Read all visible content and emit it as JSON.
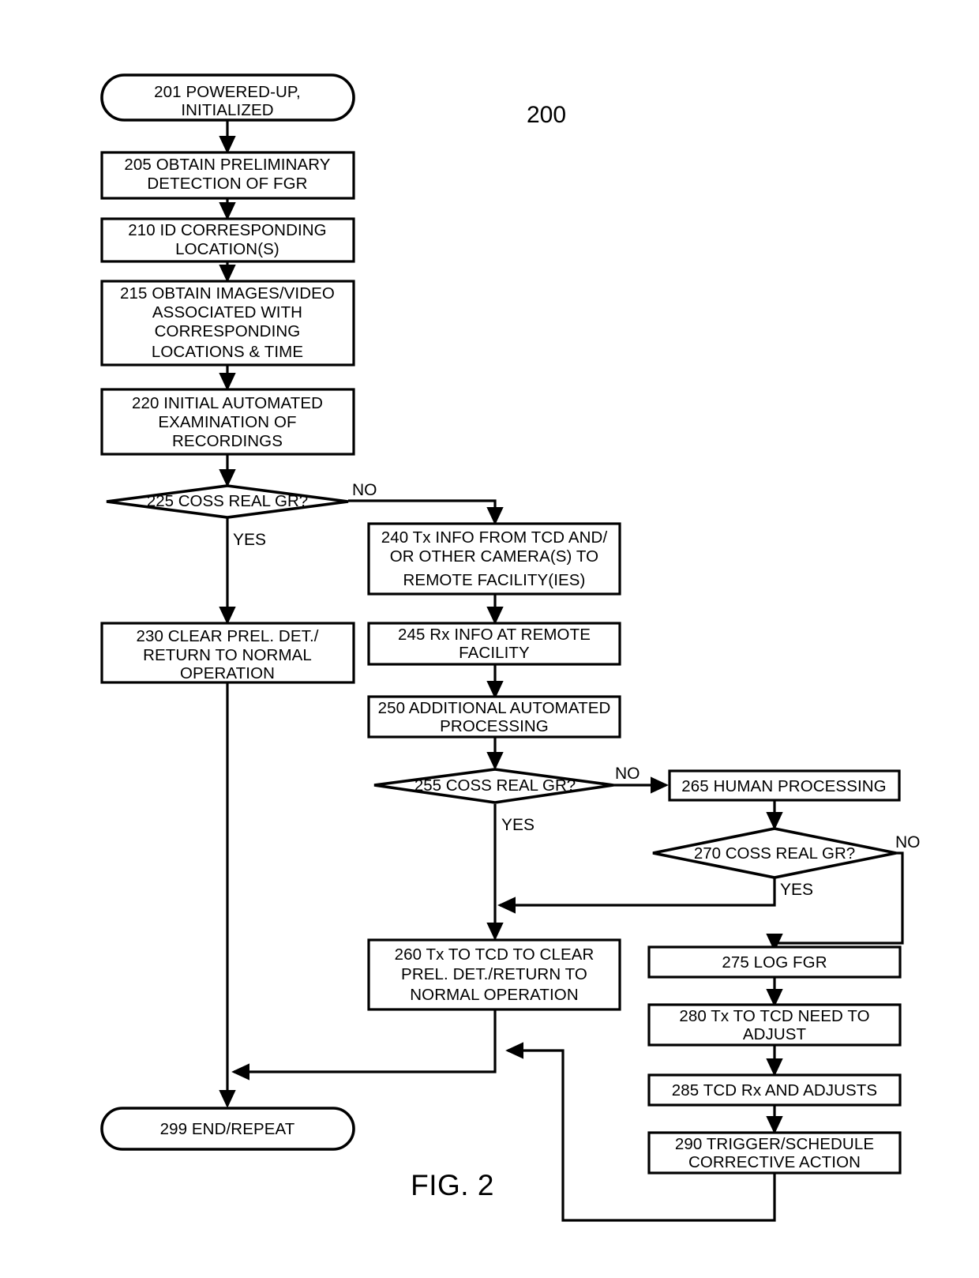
{
  "figure": {
    "caption": "FIG. 2",
    "reference_numeral": "200"
  },
  "nodes": {
    "n201": {
      "id": "201",
      "label": "201 POWERED-UP, INITIALIZED",
      "lines": [
        "201 POWERED-UP,",
        "INITIALIZED"
      ],
      "shape": "terminator"
    },
    "n205": {
      "id": "205",
      "label": "205 OBTAIN PRELIMINARY DETECTION OF FGR",
      "lines": [
        "205 OBTAIN PRELIMINARY",
        "DETECTION OF FGR"
      ],
      "shape": "process"
    },
    "n210": {
      "id": "210",
      "label": "210 ID CORRESPONDING LOCATION(S)",
      "lines": [
        "210 ID CORRESPONDING",
        "LOCATION(S)"
      ],
      "shape": "process"
    },
    "n215": {
      "id": "215",
      "label": "215 OBTAIN IMAGES/VIDEO ASSOCIATED WITH CORRESPONDING LOCATIONS & TIME",
      "lines": [
        "215 OBTAIN IMAGES/VIDEO",
        "ASSOCIATED WITH",
        "CORRESPONDING",
        "LOCATIONS & TIME"
      ],
      "shape": "process"
    },
    "n220": {
      "id": "220",
      "label": "220 INITIAL AUTOMATED EXAMINATION OF RECORDINGS",
      "lines": [
        "220 INITIAL AUTOMATED",
        "EXAMINATION OF",
        "RECORDINGS"
      ],
      "shape": "process"
    },
    "n225": {
      "id": "225",
      "label": "225 COSS REAL GR?",
      "lines": [
        "225 COSS REAL GR?"
      ],
      "shape": "decision"
    },
    "n230": {
      "id": "230",
      "label": "230 CLEAR PREL. DET./RETURN TO NORMAL OPERATION",
      "lines": [
        "230 CLEAR PREL. DET./",
        "RETURN TO NORMAL",
        "OPERATION"
      ],
      "shape": "process"
    },
    "n240": {
      "id": "240",
      "label": "240 Tx INFO FROM TCD AND/OR OTHER CAMERA(S) TO REMOTE FACILITY(IES)",
      "lines": [
        "240 Tx INFO FROM TCD AND/",
        "OR OTHER CAMERA(S) TO",
        "REMOTE FACILITY(IES)"
      ],
      "shape": "process"
    },
    "n245": {
      "id": "245",
      "label": "245 Rx INFO AT REMOTE FACILITY",
      "lines": [
        "245 Rx INFO AT REMOTE",
        "FACILITY"
      ],
      "shape": "process"
    },
    "n250": {
      "id": "250",
      "label": "250 ADDITIONAL AUTOMATED PROCESSING",
      "lines": [
        "250 ADDITIONAL AUTOMATED",
        "PROCESSING"
      ],
      "shape": "process"
    },
    "n255": {
      "id": "255",
      "label": "255 COSS REAL GR?",
      "lines": [
        "255 COSS REAL GR?"
      ],
      "shape": "decision"
    },
    "n260": {
      "id": "260",
      "label": "260 Tx TO TCD TO CLEAR PREL. DET./RETURN TO NORMAL OPERATION",
      "lines": [
        "260 Tx TO TCD TO CLEAR",
        "PREL. DET./RETURN TO",
        "NORMAL OPERATION"
      ],
      "shape": "process"
    },
    "n265": {
      "id": "265",
      "label": "265 HUMAN PROCESSING",
      "lines": [
        "265 HUMAN PROCESSING"
      ],
      "shape": "process"
    },
    "n270": {
      "id": "270",
      "label": "270 COSS REAL GR?",
      "lines": [
        "270 COSS REAL GR?"
      ],
      "shape": "decision"
    },
    "n275": {
      "id": "275",
      "label": "275 LOG FGR",
      "lines": [
        "275 LOG FGR"
      ],
      "shape": "process"
    },
    "n280": {
      "id": "280",
      "label": "280 Tx TO TCD NEED TO ADJUST",
      "lines": [
        "280 Tx TO TCD NEED TO",
        "ADJUST"
      ],
      "shape": "process"
    },
    "n285": {
      "id": "285",
      "label": "285 TCD Rx AND ADJUSTS",
      "lines": [
        "285 TCD Rx AND ADJUSTS"
      ],
      "shape": "process"
    },
    "n290": {
      "id": "290",
      "label": "290 TRIGGER/SCHEDULE CORRECTIVE ACTION",
      "lines": [
        "290 TRIGGER/SCHEDULE",
        "CORRECTIVE ACTION"
      ],
      "shape": "process"
    },
    "n299": {
      "id": "299",
      "label": "299 END/REPEAT",
      "lines": [
        "299 END/REPEAT"
      ],
      "shape": "terminator"
    }
  },
  "edge_labels": {
    "e225_no": "NO",
    "e225_yes": "YES",
    "e255_no": "NO",
    "e255_yes": "YES",
    "e270_no": "NO",
    "e270_yes": "YES"
  },
  "colors": {
    "stroke": "#000000",
    "fill": "#ffffff",
    "background": "#ffffff"
  }
}
